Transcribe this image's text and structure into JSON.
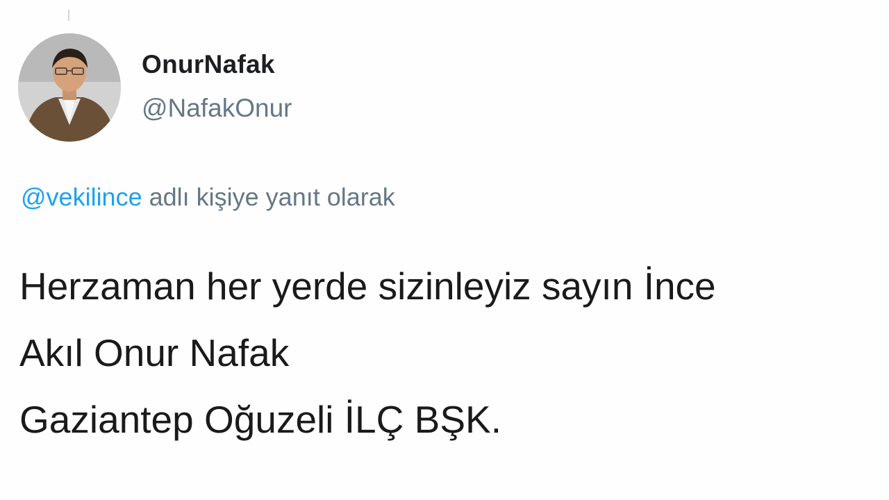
{
  "tweet": {
    "author": {
      "display_name": "OnurNafak",
      "handle": "@NafakOnur",
      "avatar_icon": "user-avatar-photo"
    },
    "reply_to": {
      "mention": "@vekilince",
      "suffix": " adlı kişiye yanıt olarak"
    },
    "text_lines": [
      "Herzaman her yerde sizinleyiz sayın İnce",
      "Akıl Onur Nafak",
      "Gaziantep Oğuzeli İLÇ BŞK."
    ]
  },
  "colors": {
    "background": "#ffffff",
    "text": "#14171a",
    "secondary_text": "#657786",
    "link": "#1da1f2"
  }
}
